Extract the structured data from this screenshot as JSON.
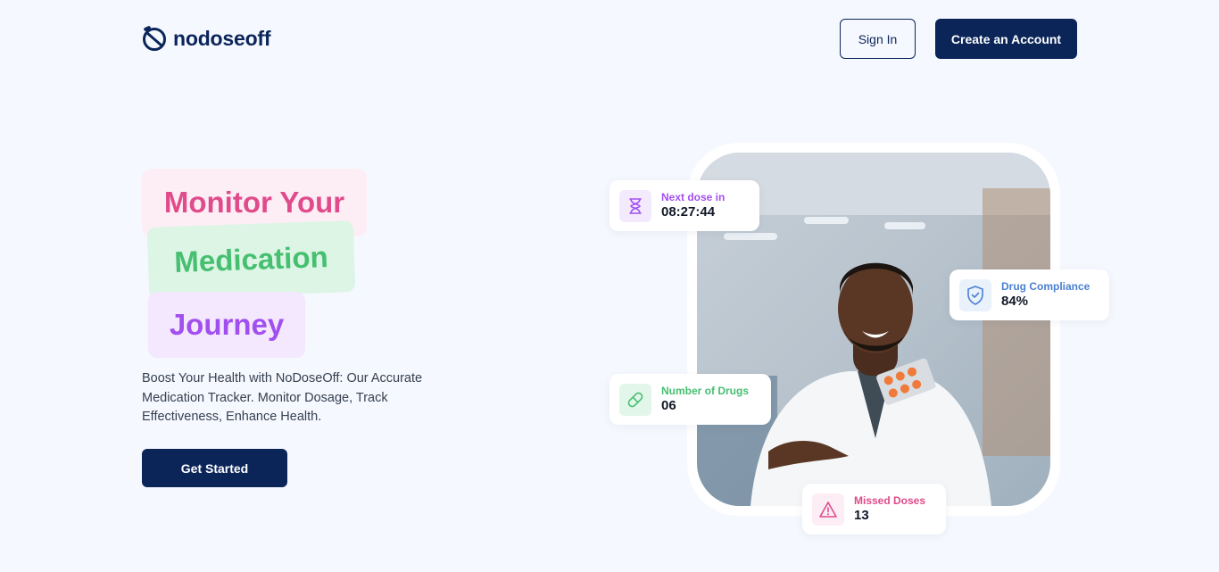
{
  "brand": {
    "name": "nodoseoff"
  },
  "nav": {
    "signin_label": "Sign In",
    "create_label": "Create an Account"
  },
  "hero": {
    "title_line1": "Monitor Your",
    "title_line2": "Medication",
    "title_line3": "Journey",
    "description": "Boost Your Health with NoDoseOff: Our Accurate Medication Tracker. Monitor Dosage, Track Effectiveness, Enhance Health.",
    "cta_label": "Get Started"
  },
  "cards": {
    "next_dose": {
      "label": "Next dose in",
      "value": "08:27:44",
      "icon": "hourglass-icon"
    },
    "compliance": {
      "label": "Drug Compliance",
      "value": "84%",
      "icon": "shield-check-icon"
    },
    "drugs": {
      "label": "Number of Drugs",
      "value": "06",
      "icon": "pill-icon"
    },
    "missed": {
      "label": "Missed Doses",
      "value": "13",
      "icon": "warning-icon"
    }
  },
  "colors": {
    "navy": "#0b2559",
    "pink": "#df4b8b",
    "green": "#46bf70",
    "purple": "#a24ff0",
    "blue": "#4a7fd1",
    "background": "#f5f8fe"
  }
}
